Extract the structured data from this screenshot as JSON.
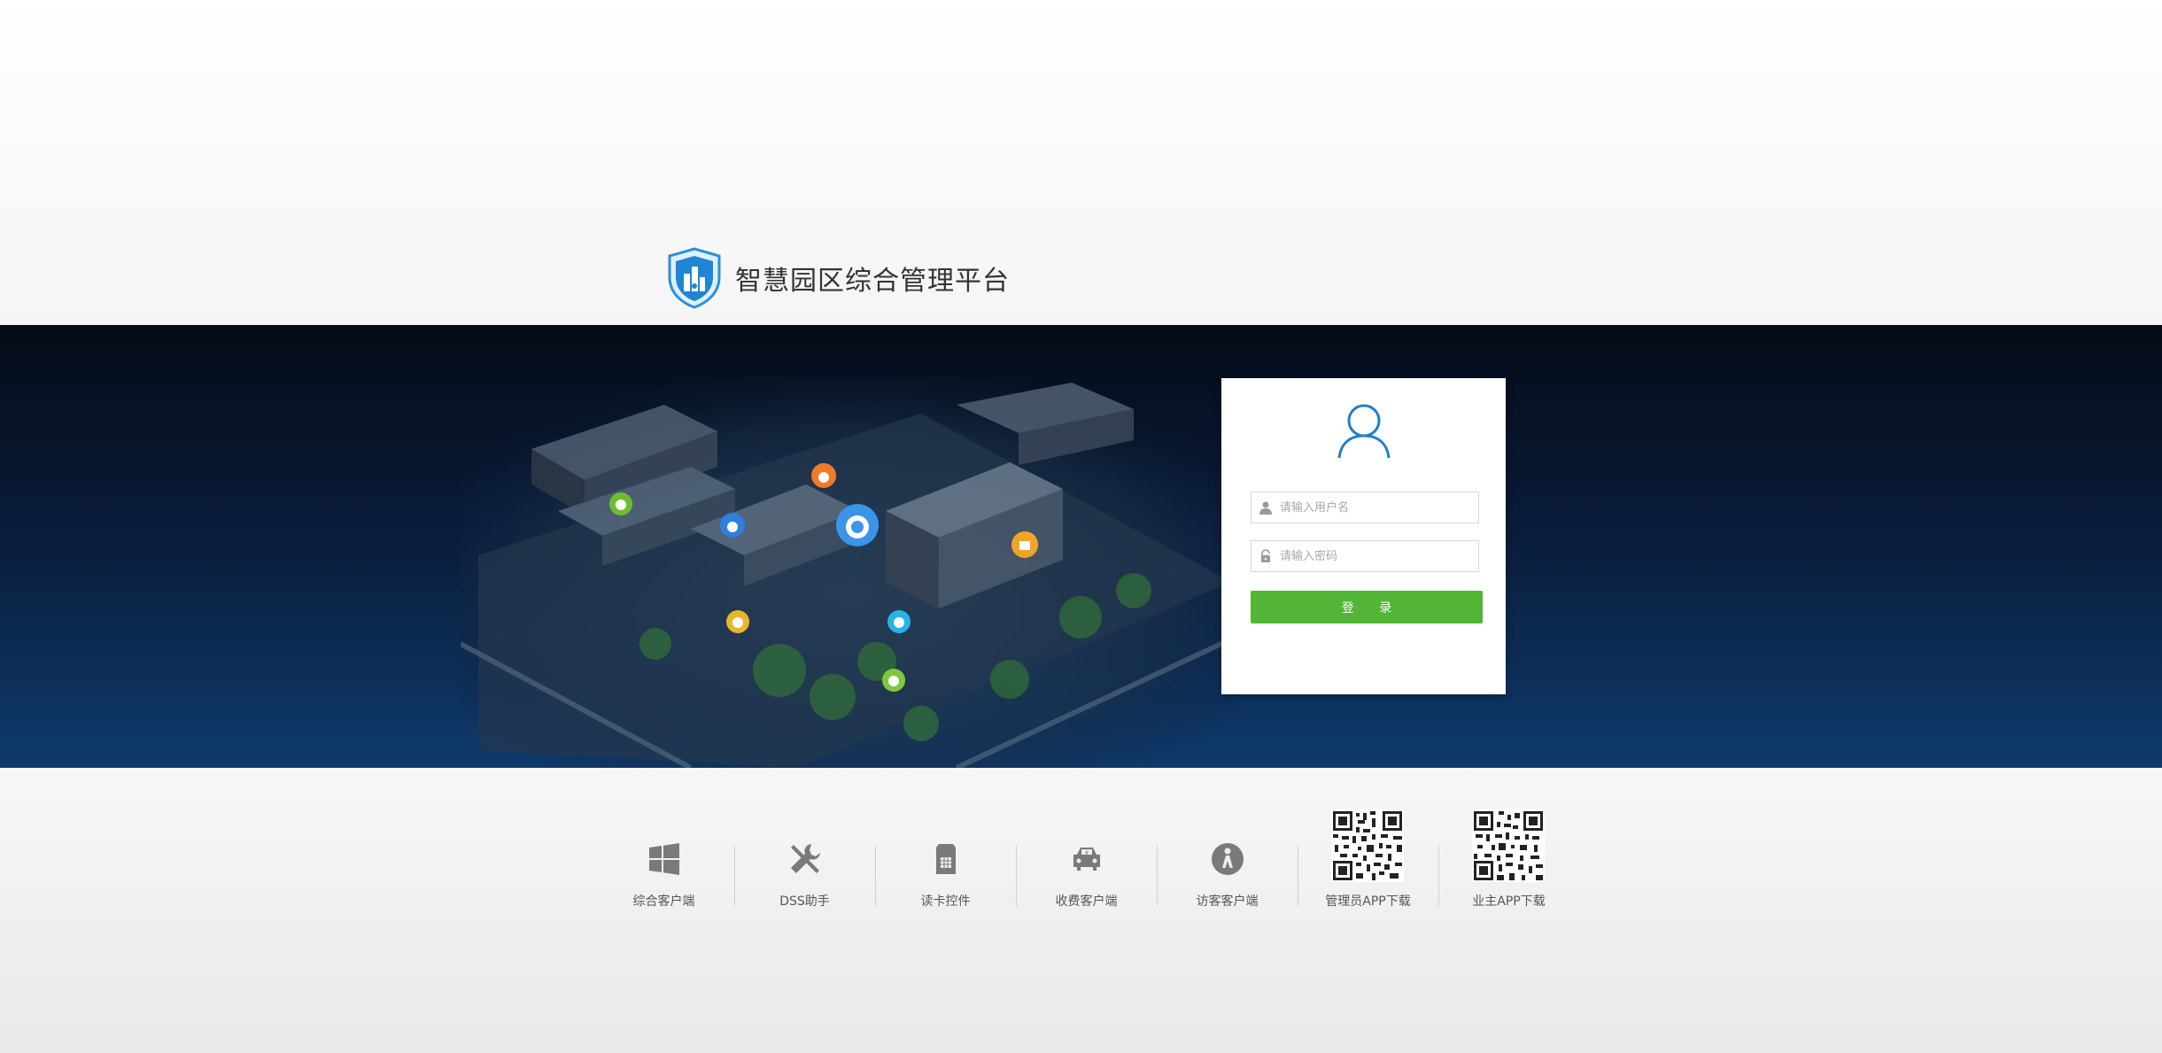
{
  "header": {
    "title": "智慧园区综合管理平台"
  },
  "login": {
    "username_placeholder": "请输入用户名",
    "password_placeholder": "请输入密码",
    "submit_label": "登 录"
  },
  "downloads": [
    {
      "label": "综合客户端",
      "icon": "windows-icon"
    },
    {
      "label": "DSS助手",
      "icon": "tools-icon"
    },
    {
      "label": "读卡控件",
      "icon": "card-reader-icon"
    },
    {
      "label": "收费客户端",
      "icon": "car-icon"
    },
    {
      "label": "访客客户端",
      "icon": "visitor-icon"
    },
    {
      "label": "管理员APP下载",
      "icon": "qr-code-icon"
    },
    {
      "label": "业主APP下载",
      "icon": "qr-code-icon"
    }
  ],
  "colors": {
    "accent_green": "#52b535",
    "brand_blue": "#1f7fd0",
    "banner_top": "#050b17",
    "banner_bottom": "#0f3b6d"
  }
}
